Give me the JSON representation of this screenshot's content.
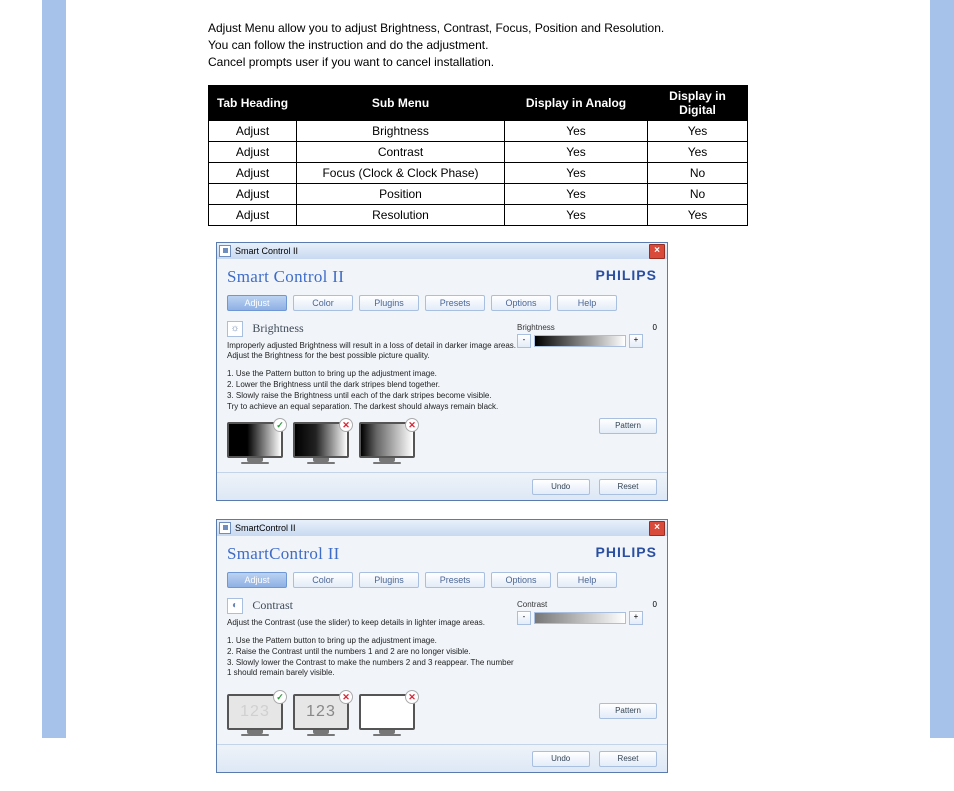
{
  "intro": {
    "line1": "Adjust Menu allow you to adjust Brightness, Contrast, Focus, Position and Resolution.",
    "line2": "You can follow the instruction and do the adjustment.",
    "line3": "Cancel prompts user if you want to cancel installation."
  },
  "table": {
    "headers": [
      "Tab Heading",
      "Sub Menu",
      "Display in Analog",
      "Display in Digital"
    ],
    "rows": [
      [
        "Adjust",
        "Brightness",
        "Yes",
        "Yes"
      ],
      [
        "Adjust",
        "Contrast",
        "Yes",
        "Yes"
      ],
      [
        "Adjust",
        "Focus (Clock & Clock Phase)",
        "Yes",
        "No"
      ],
      [
        "Adjust",
        "Position",
        "Yes",
        "No"
      ],
      [
        "Adjust",
        "Resolution",
        "Yes",
        "Yes"
      ]
    ]
  },
  "windows": {
    "brand": "PHILIPS",
    "tabs": [
      "Adjust",
      "Color",
      "Plugins",
      "Presets",
      "Options",
      "Help"
    ],
    "pattern_btn": "Pattern",
    "undo_btn": "Undo",
    "reset_btn": "Reset",
    "brightness": {
      "title": "Smart Control II",
      "app_title": "Smart Control II",
      "section": "Brightness",
      "desc": "Improperly adjusted Brightness will result in a loss of detail in darker image areas. Adjust the Brightness for the best possible picture quality.",
      "steps": [
        "1. Use the Pattern button to bring up the adjustment image.",
        "2. Lower the Brightness until the dark stripes blend together.",
        "3. Slowly raise the Brightness until each of the dark stripes become visible.",
        "    Try to achieve an equal separation. The darkest should always remain black."
      ],
      "slider_label": "Brightness",
      "slider_value": "0"
    },
    "contrast": {
      "title": "SmartControl II",
      "app_title": "SmartControl II",
      "section": "Contrast",
      "desc": "Adjust the Contrast (use the slider) to keep details in lighter image areas.",
      "steps": [
        "1. Use the Pattern button to bring up the adjustment image.",
        "2. Raise the Contrast until the numbers 1 and 2 are no longer visible.",
        "3. Slowly lower the Contrast to make the numbers 2 and 3 reappear. The number 1 should remain barely visible."
      ],
      "slider_label": "Contrast",
      "slider_value": "0",
      "thumb_text": "123"
    }
  }
}
